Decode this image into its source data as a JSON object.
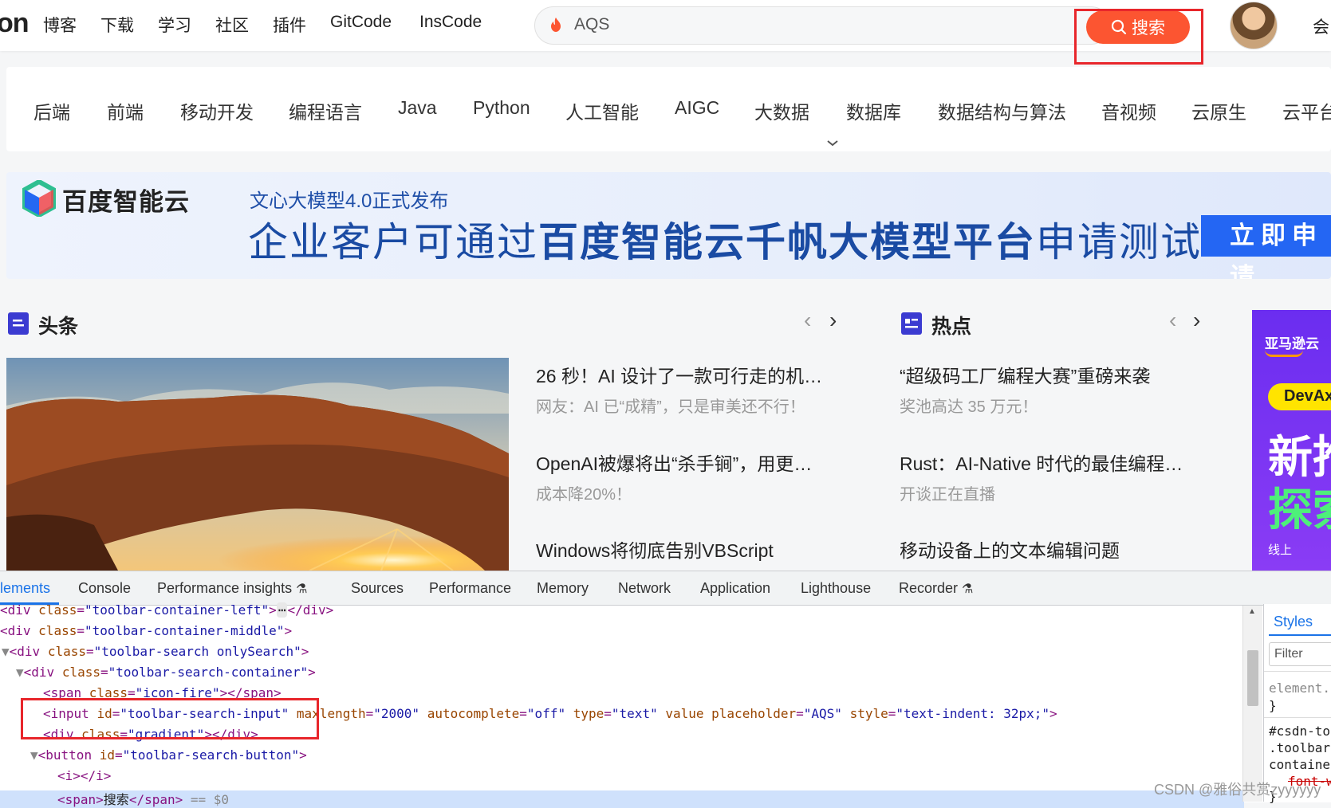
{
  "topbar": {
    "logo_fragment": "on",
    "nav": [
      "博客",
      "下载",
      "学习",
      "社区",
      "插件",
      "GitCode",
      "InsCode"
    ],
    "search_value": "AQS",
    "search_button": "搜索",
    "right_text": "会"
  },
  "categories": [
    "后端",
    "前端",
    "移动开发",
    "编程语言",
    "Java",
    "Python",
    "人工智能",
    "AIGC",
    "大数据",
    "数据库",
    "数据结构与算法",
    "音视频",
    "云原生",
    "云平台"
  ],
  "banner": {
    "brand": "百度智能云",
    "subtitle": "文心大模型4.0正式发布",
    "headline_pre": "企业客户可通过",
    "headline_bold": "百度智能云千帆大模型平台",
    "headline_post": "申请测试",
    "cta": "立即申请"
  },
  "headlines": {
    "title": "头条",
    "items": [
      {
        "title": "26 秒！AI 设计了一款可行走的机…",
        "sub": "网友：AI 已“成精”，只是审美还不行！"
      },
      {
        "title": "OpenAI被爆将出“杀手锏”，用更…",
        "sub": "成本降20%！"
      },
      {
        "title": "Windows将彻底告别VBScript",
        "sub": ""
      }
    ]
  },
  "hot": {
    "title": "热点",
    "items": [
      {
        "title": "“超级码工厂编程大赛”重磅来袭",
        "sub": "奖池高达 35 万元！"
      },
      {
        "title": "Rust：AI-Native 时代的最佳编程…",
        "sub": "开谈正在直播"
      },
      {
        "title": "移动设备上的文本编辑问题",
        "sub": ""
      }
    ]
  },
  "side_ad": {
    "brand": "亚马逊云",
    "tag": "DevAx",
    "big1": "新推",
    "big2": "探索",
    "foot": "线上"
  },
  "devtools": {
    "tabs": [
      "lements",
      "Console",
      "Performance insights",
      "Sources",
      "Performance",
      "Memory",
      "Network",
      "Application",
      "Lighthouse",
      "Recorder"
    ],
    "code": {
      "l1_tag": "<div ",
      "l1_attr": "class",
      "l1_val": "\"toolbar-container-left\"",
      "l1_end": ">",
      "l1_dots": "⋯",
      "l1_close": "</div>",
      "l2_tag": "<div ",
      "l2_attr": "class",
      "l2_val": "\"toolbar-container-middle\"",
      "l2_end": ">",
      "l3_tri": "▼",
      "l3_tag": "<div ",
      "l3_attr": "class",
      "l3_val": "\"toolbar-search onlySearch\"",
      "l3_end": ">",
      "l4_tri": "▼",
      "l4_tag": "<div ",
      "l4_attr": "class",
      "l4_val": "\"toolbar-search-container\"",
      "l4_end": ">",
      "l5_tag": "<span ",
      "l5_attr": "class",
      "l5_val": "\"icon-fire\"",
      "l5_end": "></span>",
      "l6_tag": "<input ",
      "l6_a1": "id",
      "l6_v1": "\"toolbar-search-input\"",
      "l6_a2": "maxlength",
      "l6_v2": "\"2000\"",
      "l6_a3": "autocomplete",
      "l6_v3": "\"off\"",
      "l6_a4": "type",
      "l6_v4": "\"text\"",
      "l6_a5": "value",
      "l6_a6": "placeholder",
      "l6_v6": "\"AQS\"",
      "l6_a7": "style",
      "l6_v7": "\"text-indent: 32px;\"",
      "l6_end": ">",
      "l7_tag": "<div ",
      "l7_attr": "class",
      "l7_val": "\"gradient\"",
      "l7_end": "></div>",
      "l8_tri": "▼",
      "l8_tag": "<button ",
      "l8_attr": "id",
      "l8_val": "\"toolbar-search-button\"",
      "l8_end": ">",
      "l9": "<i></i>",
      "l10_open": "<span>",
      "l10_text": "搜索",
      "l10_close": "</span>",
      "l10_eq": " == $0"
    },
    "styles_tab": "Styles",
    "filter_placeholder": "Filter",
    "styles_lines": [
      "element.s",
      "}",
      "#csdn-too",
      ".toolbar",
      "container",
      "font-w",
      "}"
    ]
  },
  "watermark": "CSDN @雅俗共赏zyyyyyy"
}
